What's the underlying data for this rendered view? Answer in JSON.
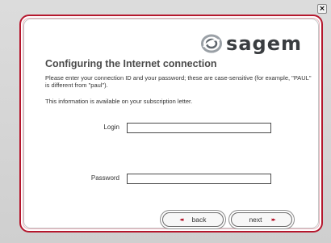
{
  "window": {
    "close_symbol": "×",
    "close_icon": "close-icon"
  },
  "brand": {
    "logo_text": "sagem",
    "accent_color": "#b5172d",
    "icon": "sagem-logo-icon"
  },
  "page": {
    "title": "Configuring the Internet connection",
    "description": "Please enter your connection ID and your password; these are case-sensitive (for example, \"PAUL\" is different from \"paul\").",
    "info": "This information is available on your subscription letter."
  },
  "form": {
    "login_label": "Login",
    "login_value": "",
    "password_label": "Password",
    "password_value": ""
  },
  "nav": {
    "back_label": "back",
    "back_arrows": "◂◂",
    "back_icon": "double-arrow-left-icon",
    "next_label": "next",
    "next_arrows": "▸▸",
    "next_icon": "double-arrow-right-icon"
  }
}
